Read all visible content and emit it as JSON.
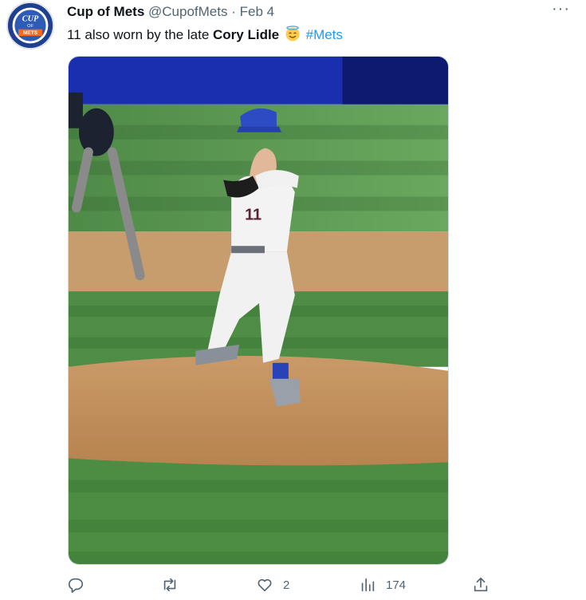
{
  "account": {
    "display_name": "Cup of Mets",
    "handle": "@CupofMets",
    "separator": "·",
    "date": "Feb 4",
    "avatar_text": [
      "CUP",
      "OF",
      "METS"
    ]
  },
  "tweet": {
    "text_before": "11 also worn by the late ",
    "bold_name": "Cory Lidle",
    "emoji": "smiling-face-with-halo",
    "hashtag": "#Mets",
    "photo_jersey_number": "11"
  },
  "more_label": "···",
  "actions": {
    "reply": {
      "icon": "reply-icon",
      "count": ""
    },
    "retweet": {
      "icon": "retweet-icon",
      "count": ""
    },
    "like": {
      "icon": "heart-icon",
      "count": "2"
    },
    "views": {
      "icon": "views-icon",
      "count": "174"
    },
    "share": {
      "icon": "share-icon",
      "count": ""
    }
  },
  "colors": {
    "accent": "#1d9bf0",
    "secondary_text": "#536471",
    "primary_text": "#0f1419"
  }
}
